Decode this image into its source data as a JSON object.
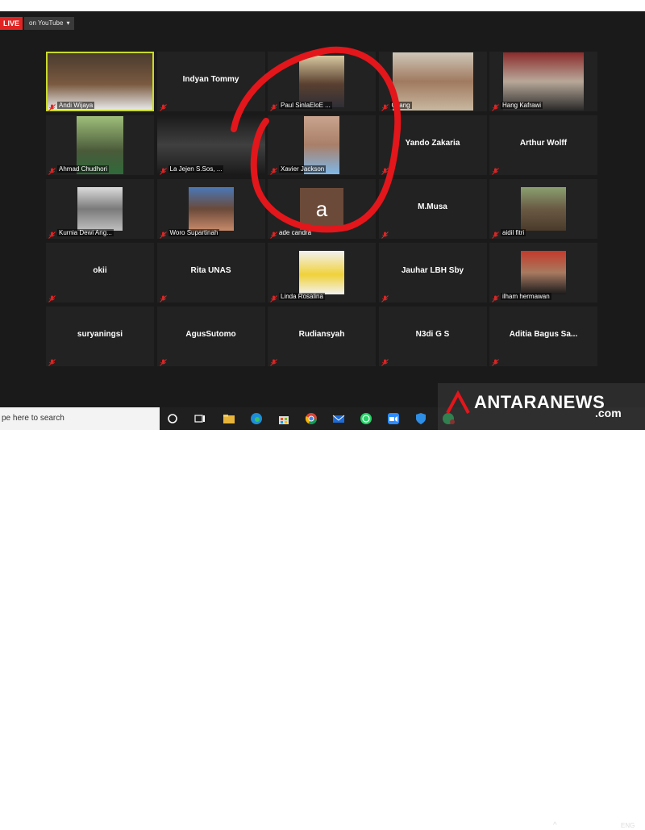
{
  "stream": {
    "live_label": "LIVE",
    "destination_label": "on YouTube",
    "dropdown_glyph": "▾",
    "live_color": "#e02424"
  },
  "participants": [
    {
      "name": "Andi Wijaya",
      "video": true,
      "active_speaker": true
    },
    {
      "name": "Indyan Tommy",
      "video": false
    },
    {
      "name": "Paul SinlaEloE ...",
      "video": true
    },
    {
      "name": "Gilang",
      "video": true
    },
    {
      "name": "Hang Kafrawi",
      "video": true
    },
    {
      "name": "Ahmad Chudhori",
      "video": true
    },
    {
      "name": "La Jejen S.Sos, ...",
      "video": true
    },
    {
      "name": "Xavier Jackson",
      "video": true
    },
    {
      "name": "Yando Zakaria",
      "video": false
    },
    {
      "name": "Arthur Wolff",
      "video": false
    },
    {
      "name": "Kurnia Dewi Ang...",
      "video": true
    },
    {
      "name": "Woro Supartinah",
      "video": true
    },
    {
      "name": "ade candra",
      "video": false,
      "avatar_letter": "a"
    },
    {
      "name": "M.Musa",
      "video": false
    },
    {
      "name": "aidil fitri",
      "video": true
    },
    {
      "name": "okii",
      "video": false
    },
    {
      "name": "Rita UNAS",
      "video": false
    },
    {
      "name": "Linda Rosalina",
      "video": true
    },
    {
      "name": "Jauhar LBH Sby",
      "video": false
    },
    {
      "name": "ilham hermawan",
      "video": true
    },
    {
      "name": "suryaningsi",
      "video": false
    },
    {
      "name": "AgusSutomo",
      "video": false
    },
    {
      "name": "Rudiansyah",
      "video": false
    },
    {
      "name": "N3di G S",
      "video": false
    },
    {
      "name": "Aditia Bagus Sa...",
      "video": false
    }
  ],
  "taskbar": {
    "search_placeholder": "pe here to search",
    "icons": [
      "cortana-icon",
      "task-view-icon",
      "file-explorer-icon",
      "edge-icon",
      "store-icon",
      "chrome-icon",
      "mail-icon",
      "whatsapp-icon",
      "zoom-icon",
      "security-icon",
      "whatsapp-notify-icon"
    ],
    "tray_up_glyph": "^",
    "language": "ENG"
  },
  "watermark": {
    "brand": "ANTARANEWS",
    "suffix": ".com"
  },
  "annotation": {
    "circle_color": "#e3161b"
  }
}
